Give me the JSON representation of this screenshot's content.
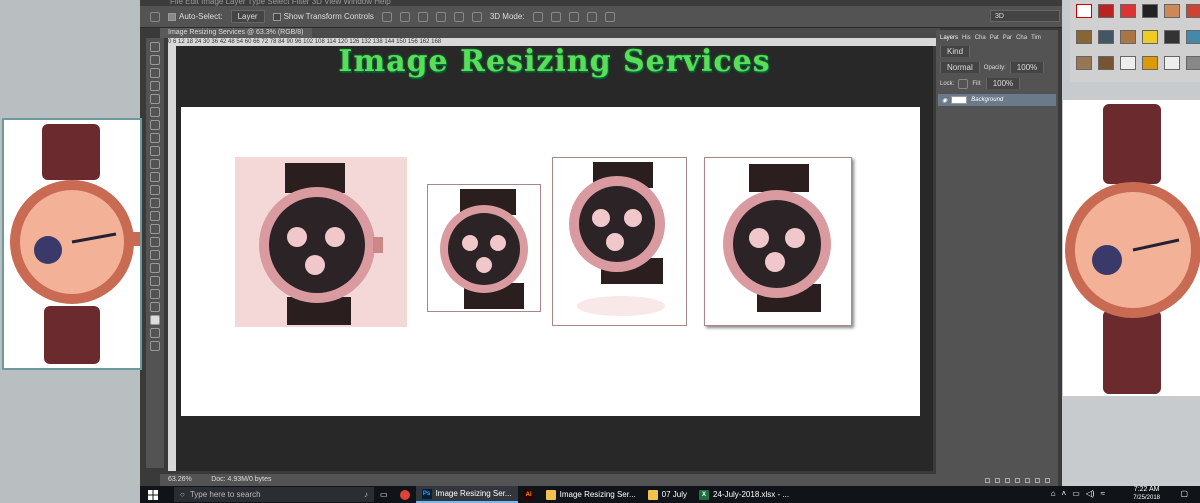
{
  "menubar": {
    "items": "File  Edit  Image  Layer  Type  Select  Filter  3D  View  Window  Help"
  },
  "options": {
    "auto_select_label": "Auto-Select:",
    "auto_select_value": "Layer",
    "transform_label": "Show Transform Controls",
    "mode3d_label": "3D Mode:",
    "mode3d_value": "3D"
  },
  "document": {
    "tab_title": "Image Resizing Services @ 63.3% (RGB/8)",
    "ruler_ticks": "0   6   12   18   24   30   36   42   48   54   60   66   72   78   84   90   96   102   108   114   120   126   132   138   144   150   156   162   168"
  },
  "canvas": {
    "title": "Image Resizing Services"
  },
  "status": {
    "zoom": "63.26%",
    "doc": "Doc: 4.93M/0 bytes"
  },
  "layers_panel": {
    "tabs": [
      "Layers",
      "His",
      "Cha",
      "Pat",
      "Par",
      "Cha",
      "Tim"
    ],
    "kind_label": "Kind",
    "blend_mode": "Normal",
    "opacity_label": "Opacity:",
    "opacity_value": "100%",
    "lock_label": "Lock:",
    "fill_label": "Fill:",
    "fill_value": "100%",
    "layer_name": "Background"
  },
  "taskbar": {
    "search_placeholder": "Type here to search",
    "items": [
      {
        "label": "Image Resizing Ser...",
        "icon": "Ps",
        "color": "#31a8ff",
        "bg": "#001e36"
      },
      {
        "label": "",
        "icon": "Ai",
        "color": "#ff9a00",
        "bg": "#330000"
      },
      {
        "label": "Image Resizing Ser...",
        "icon": "folder",
        "color": "#f2c14e",
        "bg": ""
      },
      {
        "label": "07 July",
        "icon": "folder",
        "color": "#f2c14e",
        "bg": ""
      },
      {
        "label": "24-July-2018.xlsx - ...",
        "icon": "X",
        "color": "#ffffff",
        "bg": "#1d6f42"
      }
    ],
    "time": "7:22 AM",
    "date": "7/25/2018"
  },
  "colors": {
    "accent": "#5bdc5b",
    "watch_tint": "#e8a2a6",
    "strap": "#6b2a2e"
  }
}
